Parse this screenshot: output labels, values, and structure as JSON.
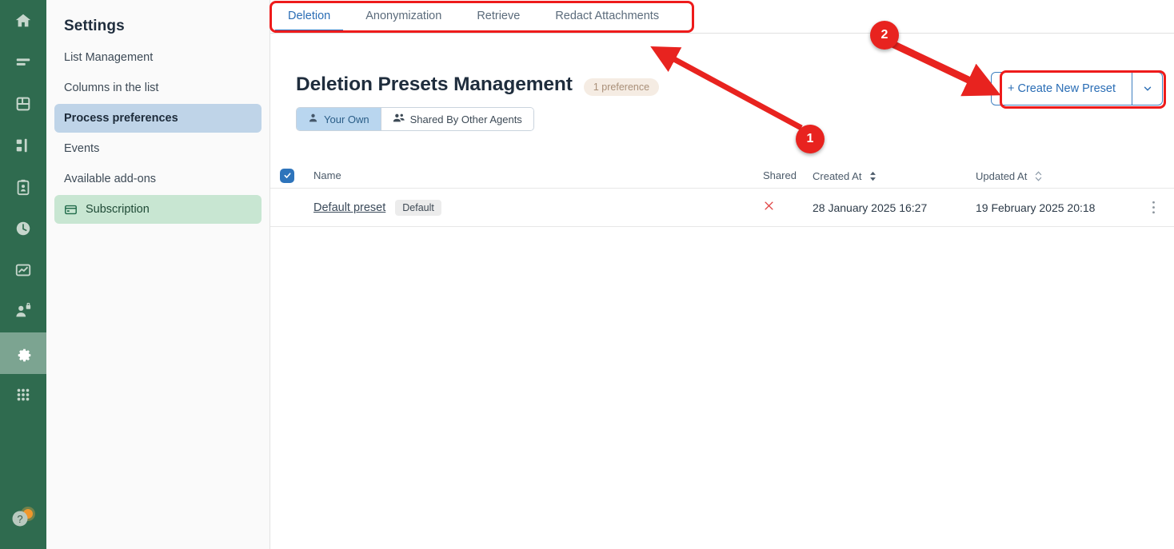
{
  "icon_rail": {
    "items": [
      {
        "name": "home-icon",
        "label": "Home"
      },
      {
        "name": "lines-icon",
        "label": "Queues"
      },
      {
        "name": "database-icon",
        "label": "Records"
      },
      {
        "name": "org-chart-icon",
        "label": "Organization"
      },
      {
        "name": "clipboard-user-icon",
        "label": "Tasks"
      },
      {
        "name": "clock-icon",
        "label": "History"
      },
      {
        "name": "chart-icon",
        "label": "Reports"
      },
      {
        "name": "user-lock-icon",
        "label": "Access"
      },
      {
        "name": "gear-icon",
        "label": "Settings",
        "active": true
      },
      {
        "name": "grid-apps-icon",
        "label": "Apps"
      }
    ],
    "help": {
      "name": "help-icon",
      "label": "Help"
    }
  },
  "settings": {
    "title": "Settings",
    "items": [
      {
        "label": "List Management",
        "state": "normal"
      },
      {
        "label": "Columns in the list",
        "state": "normal"
      },
      {
        "label": "Process preferences",
        "state": "selected-blue"
      },
      {
        "label": "Events",
        "state": "normal"
      },
      {
        "label": "Available add-ons",
        "state": "normal"
      },
      {
        "label": "Subscription",
        "state": "selected-green",
        "icon": "credit-card-icon"
      }
    ]
  },
  "tabs": [
    {
      "label": "Deletion",
      "active": true
    },
    {
      "label": "Anonymization",
      "active": false
    },
    {
      "label": "Retrieve",
      "active": false
    },
    {
      "label": "Redact Attachments",
      "active": false
    }
  ],
  "page": {
    "title": "Deletion Presets Management",
    "badge": "1 preference"
  },
  "toggle_group": [
    {
      "label": "Your Own",
      "icon": "user-icon",
      "active": true
    },
    {
      "label": "Shared By Other Agents",
      "icon": "users-icon",
      "active": false
    }
  ],
  "create": {
    "label": "+ Create New Preset",
    "caret": "chevron-down-icon"
  },
  "table": {
    "headers": {
      "name": "Name",
      "shared": "Shared",
      "created_at": "Created At",
      "updated_at": "Updated At"
    },
    "rows": [
      {
        "name": "Default preset",
        "tag": "Default",
        "shared": "×",
        "created_at": "28 January 2025 16:27",
        "updated_at": "19 February 2025 20:18"
      }
    ]
  },
  "annotations": [
    {
      "number": "1"
    },
    {
      "number": "2"
    }
  ],
  "colors": {
    "rail_green": "#2f6b4f",
    "rail_active": "#7ca491",
    "accent_blue": "#2a6db5",
    "annotation_red": "#ee1b1b",
    "selected_blue": "#bfd4e8",
    "selected_green": "#c8e6d2",
    "badge_beige": "#f5ece3"
  }
}
